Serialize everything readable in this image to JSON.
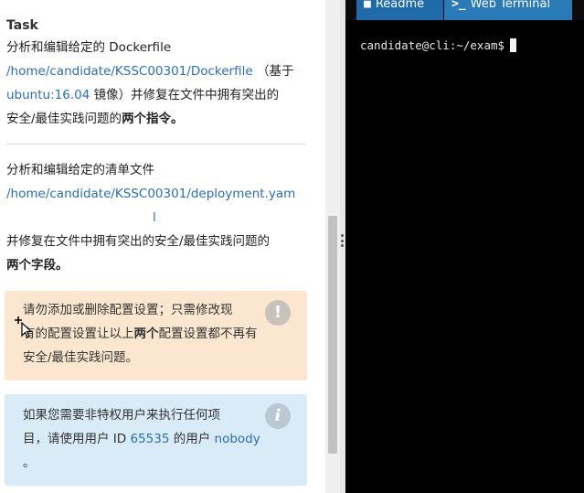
{
  "task": {
    "title": "Task",
    "intro_1": "分析和编辑给定的 Dockerfile",
    "dockerfile_path": "/home/candidate/KSSC00301/Dockerfile",
    "intro_1_suffix": "（基于",
    "base_image": "ubuntu:16.04",
    "intro_1_cont": "镜像）并修复在文件中拥有突出的",
    "intro_1_end": "安全/最佳实践问题的",
    "intro_1_bold": "两个指令。",
    "intro_2": "分析和编辑给定的清单文件",
    "manifest_path_1": "/home/candidate/KSSC00301/deployment.yam",
    "manifest_path_2": "l",
    "intro_2_cont": "并修复在文件中拥有突出的安全/最佳实践问题的",
    "intro_2_bold": "两个字段。"
  },
  "warning": {
    "line_1": "请勿添加或删除配置设置；只需修改现",
    "line_2_pre": "有的配置设置让以上",
    "line_2_bold": "两个",
    "line_2_post": "配置设置都不再有",
    "line_3": "安全/最佳实践问题。",
    "icon": "exclamation-icon"
  },
  "info": {
    "line_1": "如果您需要非特权用户来执行任何项",
    "line_2_pre": "目，请使用用户 ID",
    "user_id": "65535",
    "line_2_mid": "的用户",
    "user_name": "nobody",
    "line_3": "。",
    "icon": "info-icon"
  },
  "terminal": {
    "tabs": [
      {
        "label": "Readme",
        "icon": "readme-icon"
      },
      {
        "label": "Web Terminal",
        "icon": "terminal-icon"
      }
    ],
    "prompt": "candidate@cli:~/exam$"
  },
  "colors": {
    "link": "#2a6fb5",
    "warning_bg": "#fbe7cf",
    "info_bg": "#d9ebf7",
    "tab_active": "#2a7ab8",
    "terminal_bg": "#000000"
  }
}
